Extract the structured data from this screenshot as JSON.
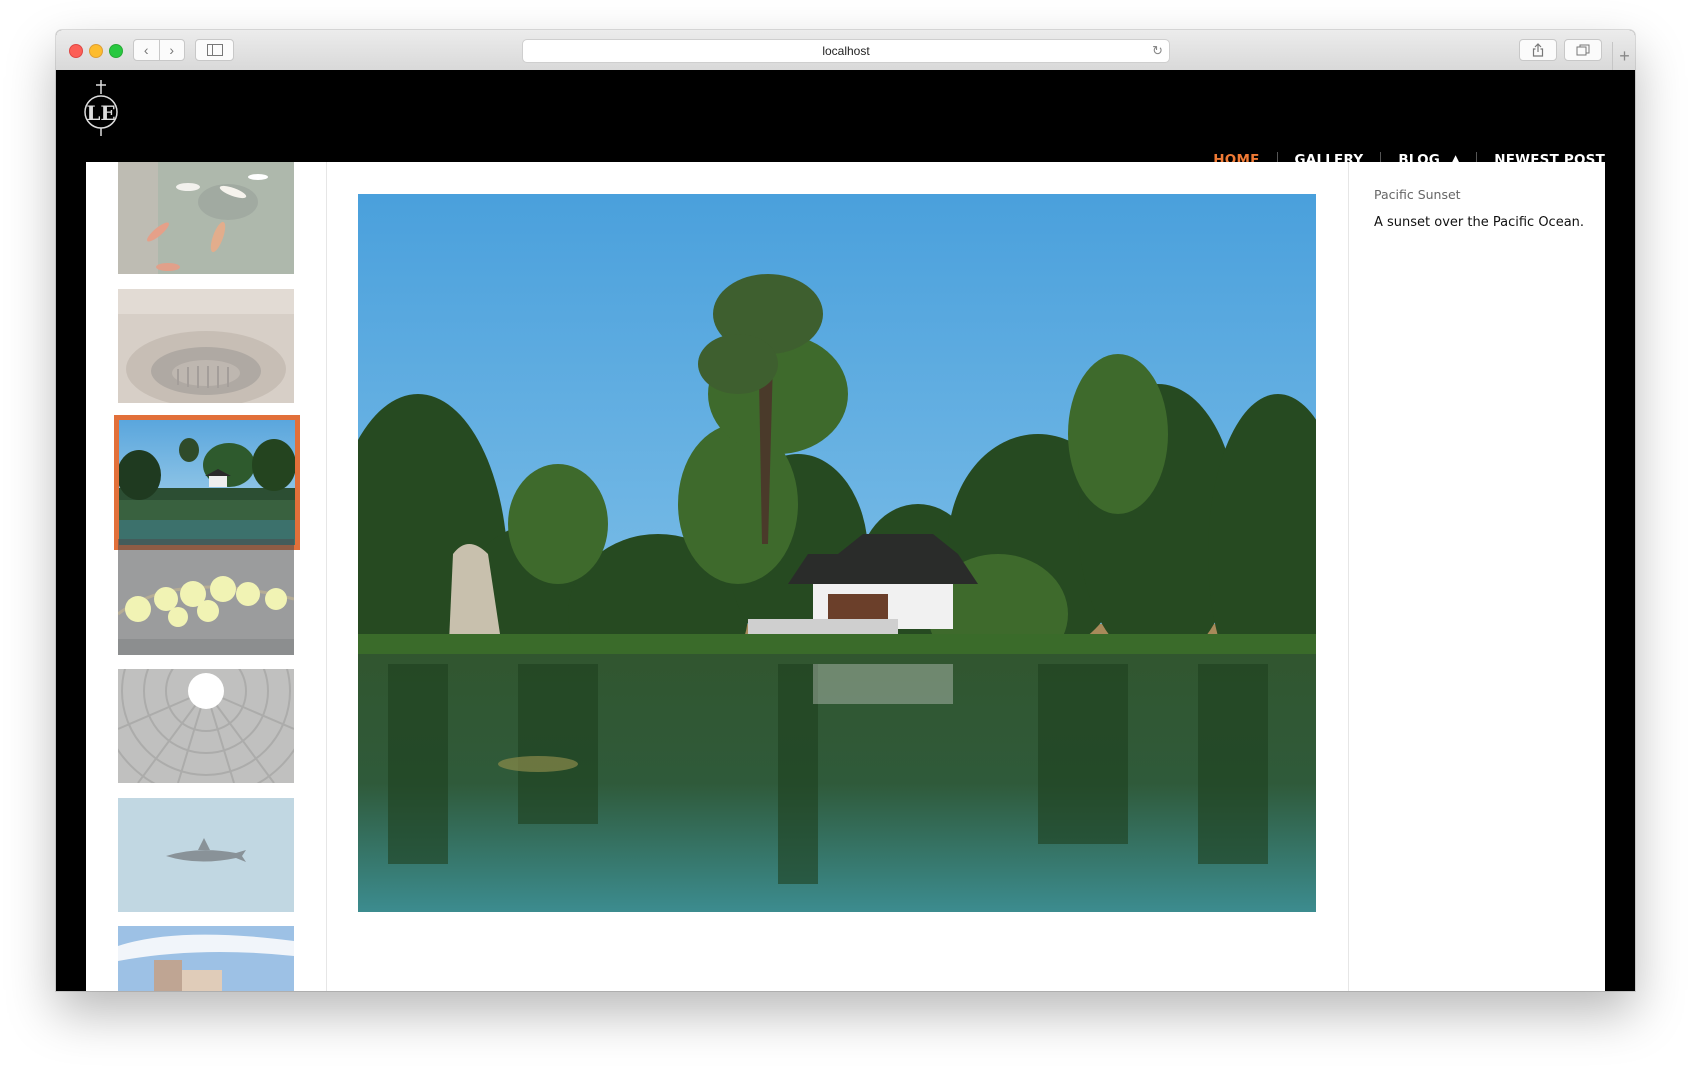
{
  "browser": {
    "url": "localhost"
  },
  "nav": {
    "items": [
      {
        "label": "HOME",
        "active": true
      },
      {
        "label": "GALLERY",
        "active": false
      },
      {
        "label": "BLOG",
        "active": false,
        "has_dropdown": true
      },
      {
        "label": "NEWEST POST",
        "active": false
      }
    ]
  },
  "gallery": {
    "thumbnails": [
      {
        "subject": "koi-pond",
        "selected": false
      },
      {
        "subject": "colosseum",
        "selected": false
      },
      {
        "subject": "garden-lake",
        "selected": true
      },
      {
        "subject": "orchids",
        "selected": false
      },
      {
        "subject": "pantheon-dome",
        "selected": false
      },
      {
        "subject": "shark",
        "selected": false
      },
      {
        "subject": "sky-building",
        "selected": false
      }
    ],
    "main_photo": "garden-lake"
  },
  "info": {
    "title": "Pacific Sunset",
    "description": "A sunset over the Pacific Ocean."
  },
  "colors": {
    "accent": "#f07a35",
    "selected_border": "#e2703a",
    "header_bg": "#000000"
  },
  "icons": [
    "back-icon",
    "forward-icon",
    "sidebar-icon",
    "reload-icon",
    "share-icon",
    "tabs-icon",
    "new-tab-icon",
    "logo"
  ]
}
